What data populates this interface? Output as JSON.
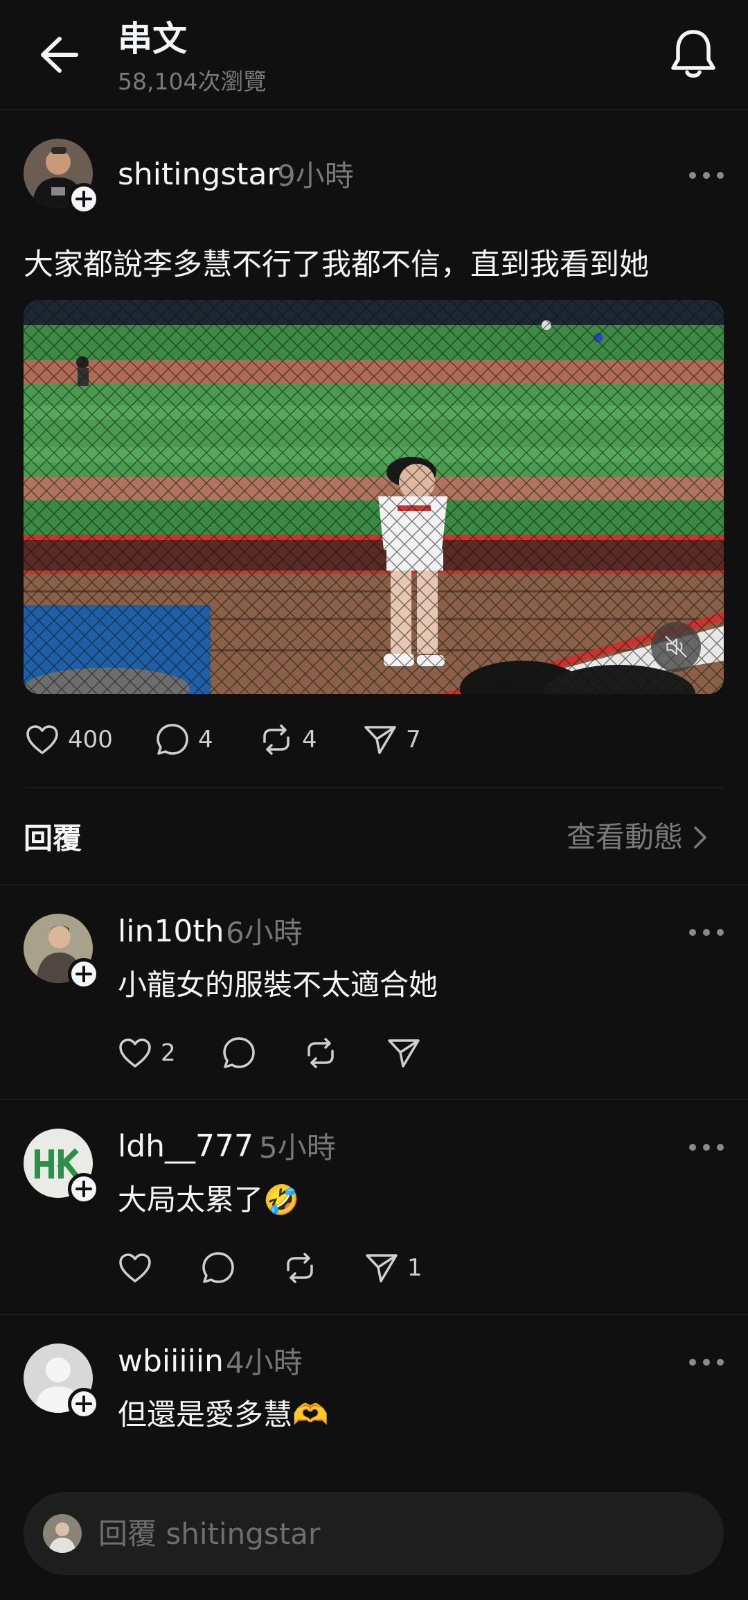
{
  "header": {
    "title": "串文",
    "views": "58,104次瀏覽"
  },
  "post": {
    "username": "shitingstar",
    "time": "9小時",
    "text": "大家都說李多慧不行了我都不信，直到我看到她",
    "likes": "400",
    "comments": "4",
    "reposts": "4",
    "shares": "7"
  },
  "replies_section": {
    "label": "回覆",
    "activity_link": "查看動態"
  },
  "comments": [
    {
      "username": "lin10th",
      "time": "6小時",
      "text": "小龍女的服裝不太適合她",
      "likes": "2",
      "replies": "",
      "reposts": "",
      "shares": ""
    },
    {
      "username": "ldh__777",
      "time": "5小時",
      "text": "大局太累了🤣",
      "likes": "",
      "replies": "",
      "reposts": "",
      "shares": "1"
    },
    {
      "username": "wbiiiiin",
      "time": "4小時",
      "text": "但還是愛多慧🫶"
    }
  ],
  "reply_bar": {
    "placeholder": "回覆 shitingstar"
  },
  "colors": {
    "background": "#101010",
    "text": "#f3f5f7",
    "secondary": "#777777"
  }
}
